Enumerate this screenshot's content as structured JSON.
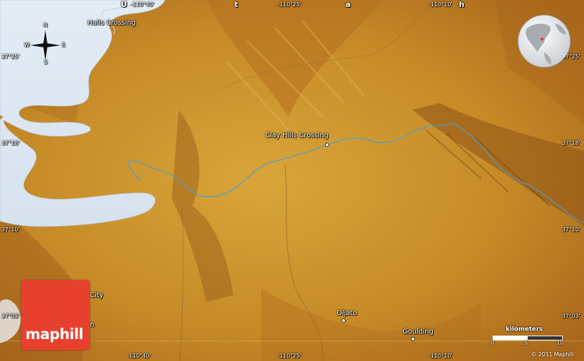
{
  "map": {
    "logo_text": "maphill",
    "copyright": "© 2011 Maphill",
    "scale": {
      "title": "kilometers",
      "ticks": [
        "0",
        "5",
        "10"
      ]
    },
    "compass": {
      "n": "N",
      "s": "S",
      "e": "E",
      "w": "W"
    },
    "grid_letters": [
      "U",
      "t",
      "a",
      "h"
    ],
    "coords_top": [
      "-110°40'",
      "-110°25'",
      "-110°10'"
    ],
    "coords_bottom": [
      "-110°40'",
      "-110°25'",
      "-110°10'"
    ],
    "coords_left": [
      "37°25'",
      "37°18'",
      "37°10'",
      "37°03'"
    ],
    "coords_right": [
      "37°25'",
      "37°18'",
      "37°10'",
      "37°03'"
    ],
    "places": {
      "halls_crossing": "Halls Crossing",
      "clay_hills_crossing": "Clay Hills Crossing",
      "oljato": "Oljato",
      "goulding": "Goulding",
      "city_fragment": "City",
      "n_fragment": "n"
    },
    "colors": {
      "terrain": "#c98f2a",
      "water": "#dde8f3",
      "river": "#4a9fd0",
      "logo": "#e8402f"
    }
  }
}
